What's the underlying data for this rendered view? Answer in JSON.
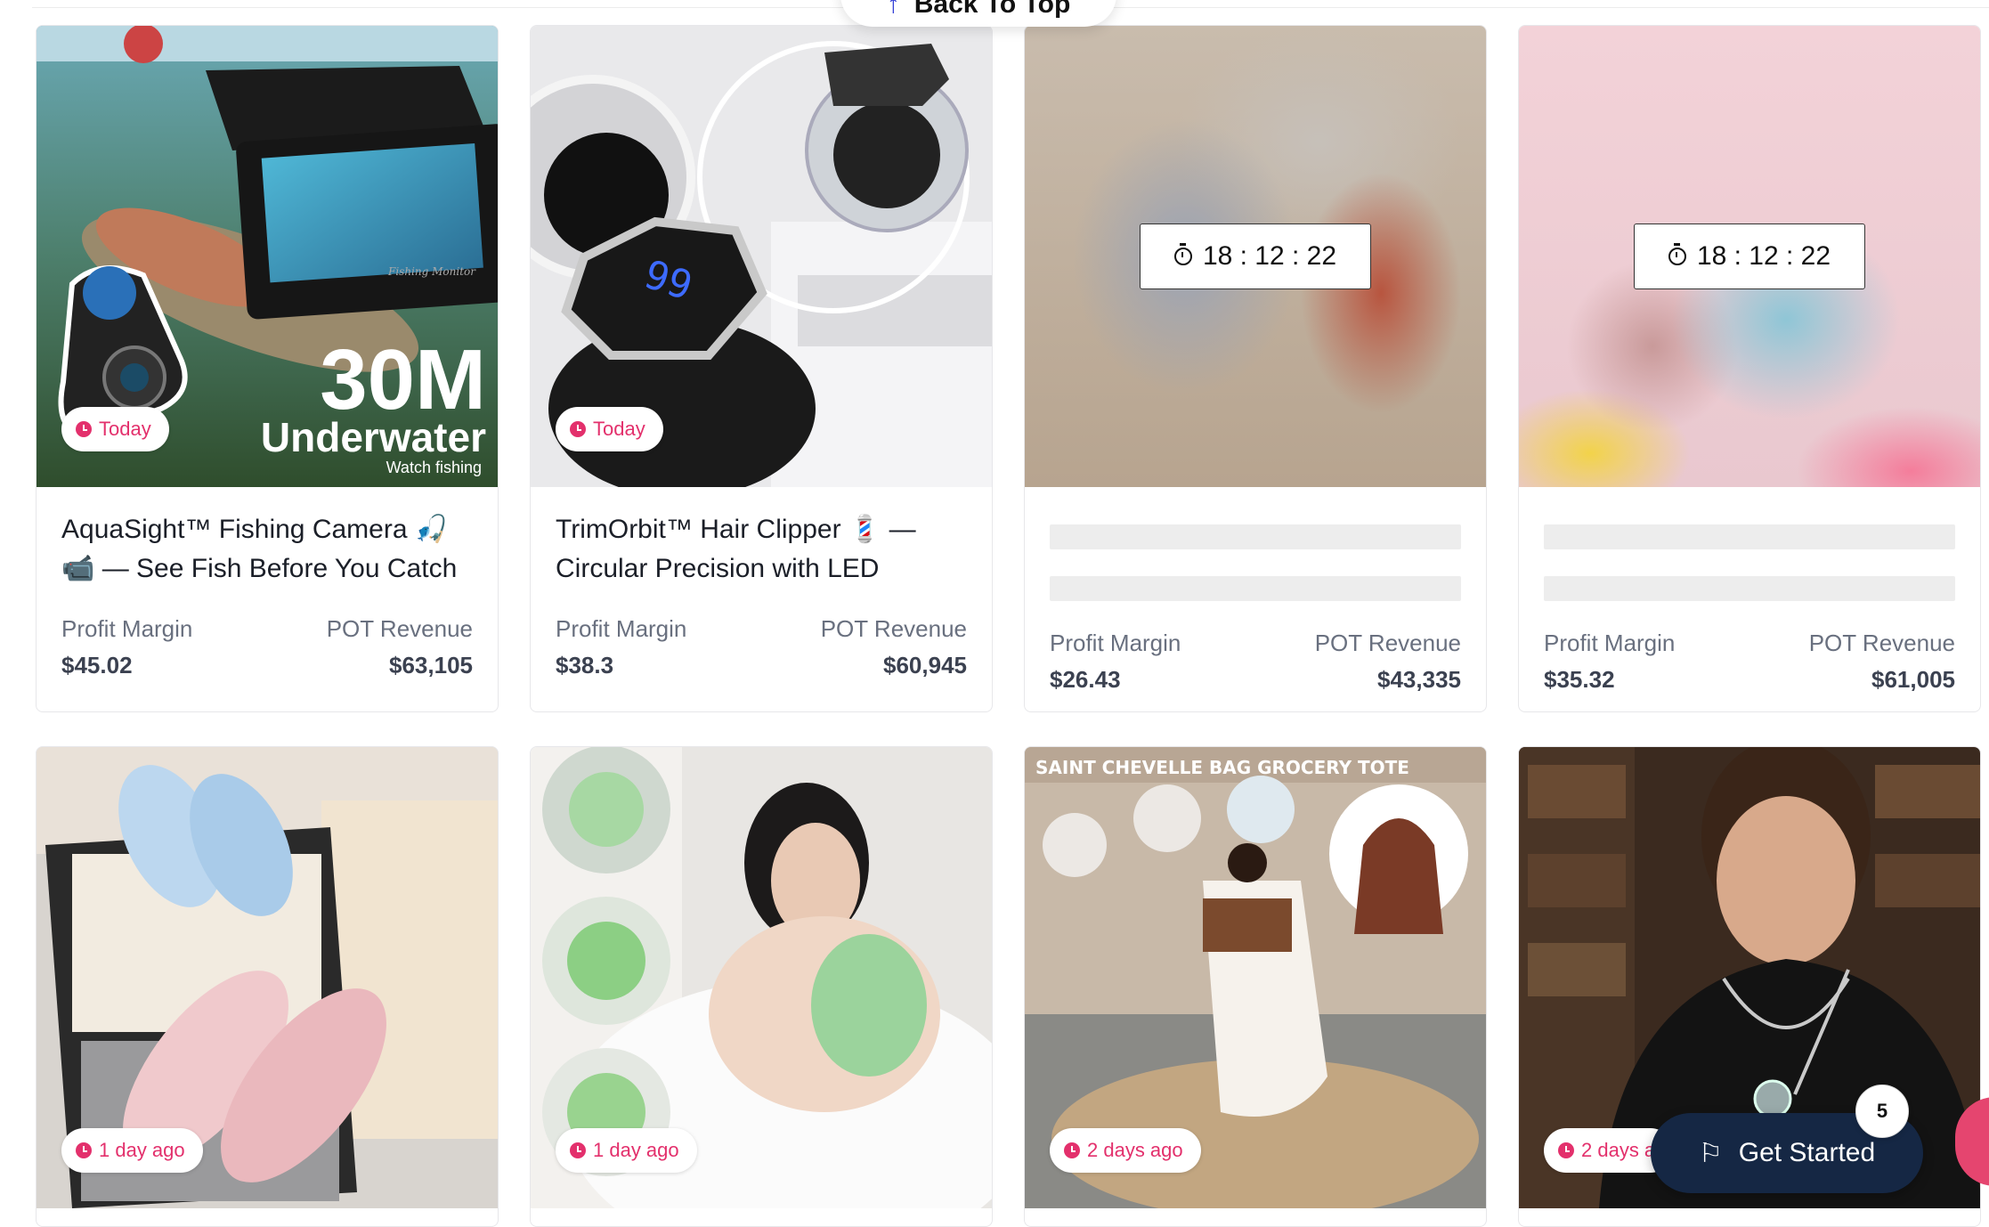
{
  "back_to_top": {
    "label": "Back To Top"
  },
  "products": [
    {
      "title": "AquaSight™ Fishing Camera 🎣📹 — See Fish Before You Catch",
      "badge": "Today",
      "image_overlay": {
        "headline": "30M",
        "subhead": "Underwater",
        "caption": "Watch fishing",
        "screen_label": "Fishing Monitor"
      },
      "profit_margin_label": "Profit Margin",
      "profit_margin": "$45.02",
      "revenue_label": "POT Revenue",
      "revenue": "$63,105"
    },
    {
      "title": "TrimOrbit™ Hair Clipper 💈 — Circular Precision with LED",
      "badge": "Today",
      "image_overlay": {
        "display_digits": "99"
      },
      "profit_margin_label": "Profit Margin",
      "profit_margin": "$38.3",
      "revenue_label": "POT Revenue",
      "revenue": "$60,945"
    },
    {
      "locked": true,
      "timer": "18 : 12 : 22",
      "profit_margin_label": "Profit Margin",
      "profit_margin": "$26.43",
      "revenue_label": "POT Revenue",
      "revenue": "$43,335"
    },
    {
      "locked": true,
      "timer": "18 : 12 : 22",
      "profit_margin_label": "Profit Margin",
      "profit_margin": "$35.32",
      "revenue_label": "POT Revenue",
      "revenue": "$61,005"
    },
    {
      "badge": "1 day ago"
    },
    {
      "badge": "1 day ago"
    },
    {
      "badge": "2 days ago",
      "image_overlay": {
        "banner": "SAINT CHEVELLE BAG GROCERY TOTE"
      }
    },
    {
      "badge": "2 days a"
    }
  ],
  "get_started": {
    "label": "Get Started",
    "count": "5"
  },
  "colors": {
    "accent_pink": "#e3306c",
    "button_navy": "#152744"
  }
}
